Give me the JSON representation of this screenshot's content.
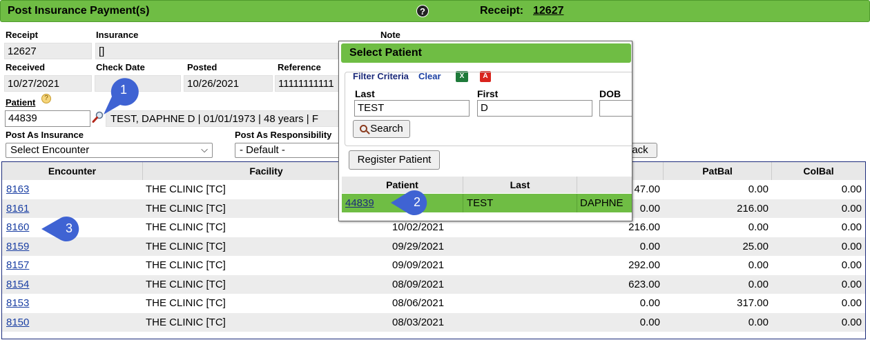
{
  "header": {
    "title": "Post Insurance Payment(s)",
    "help_glyph": "?",
    "receipt_label": "Receipt:",
    "receipt_number": "12627"
  },
  "form": {
    "receipt_label": "Receipt",
    "receipt_value": "12627",
    "insurance_label": "Insurance",
    "insurance_value": "[]",
    "note_label": "Note",
    "received_label": "Received",
    "received_value": "10/27/2021",
    "check_date_label": "Check Date",
    "check_date_value": "",
    "posted_label": "Posted",
    "posted_value": "10/26/2021",
    "reference_label": "Reference",
    "reference_value": "11111111111",
    "patient_label": "Patient",
    "patient_help_glyph": "?",
    "patient_value": "44839",
    "patient_details": "TEST, DAPHNE D | 01/01/1973 | 48 years | F",
    "post_as_insurance_label": "Post As Insurance",
    "post_as_insurance_value": "Select Encounter",
    "post_as_responsibility_label": "Post As Responsibility",
    "post_as_responsibility_value": "- Default -",
    "back_button_partial": "ack"
  },
  "table": {
    "columns": [
      "Encounter",
      "Facility",
      "",
      "",
      "PatBal",
      "ColBal"
    ],
    "rows": [
      {
        "encounter": "8163",
        "facility": "THE CLINIC [TC]",
        "date": "",
        "amount": "47.00",
        "patbal": "0.00",
        "colbal": "0.00"
      },
      {
        "encounter": "8161",
        "facility": "THE CLINIC [TC]",
        "date": "",
        "amount": "0.00",
        "patbal": "216.00",
        "colbal": "0.00"
      },
      {
        "encounter": "8160",
        "facility": "THE CLINIC [TC]",
        "date": "10/02/2021",
        "amount": "216.00",
        "patbal": "0.00",
        "colbal": "0.00"
      },
      {
        "encounter": "8159",
        "facility": "THE CLINIC [TC]",
        "date": "09/29/2021",
        "amount": "0.00",
        "patbal": "25.00",
        "colbal": "0.00"
      },
      {
        "encounter": "8157",
        "facility": "THE CLINIC [TC]",
        "date": "09/09/2021",
        "amount": "292.00",
        "patbal": "0.00",
        "colbal": "0.00"
      },
      {
        "encounter": "8154",
        "facility": "THE CLINIC [TC]",
        "date": "08/09/2021",
        "amount": "623.00",
        "patbal": "0.00",
        "colbal": "0.00"
      },
      {
        "encounter": "8153",
        "facility": "THE CLINIC [TC]",
        "date": "08/06/2021",
        "amount": "0.00",
        "patbal": "317.00",
        "colbal": "0.00"
      },
      {
        "encounter": "8150",
        "facility": "THE CLINIC [TC]",
        "date": "08/03/2021",
        "amount": "0.00",
        "patbal": "0.00",
        "colbal": "0.00"
      }
    ]
  },
  "modal": {
    "title": "Select Patient",
    "filter_criteria_label": "Filter Criteria",
    "clear_link": "Clear",
    "excel_glyph": "X",
    "pdf_glyph": "A",
    "last_label": "Last",
    "last_value": "TEST",
    "first_label": "First",
    "first_value": "D",
    "dob_label": "DOB",
    "dob_value": "",
    "search_button": "Search",
    "register_button": "Register Patient",
    "result_columns": [
      "Patient",
      "Last",
      ""
    ],
    "result_row": {
      "patient": "44839",
      "last": "TEST",
      "first": "DAPHNE"
    }
  },
  "callouts": {
    "one": "1",
    "two": "2",
    "three": "3"
  },
  "colors": {
    "header_green": "#6fbd44",
    "callout_blue": "#3f63d3",
    "link_blue": "#1a3fa3"
  }
}
